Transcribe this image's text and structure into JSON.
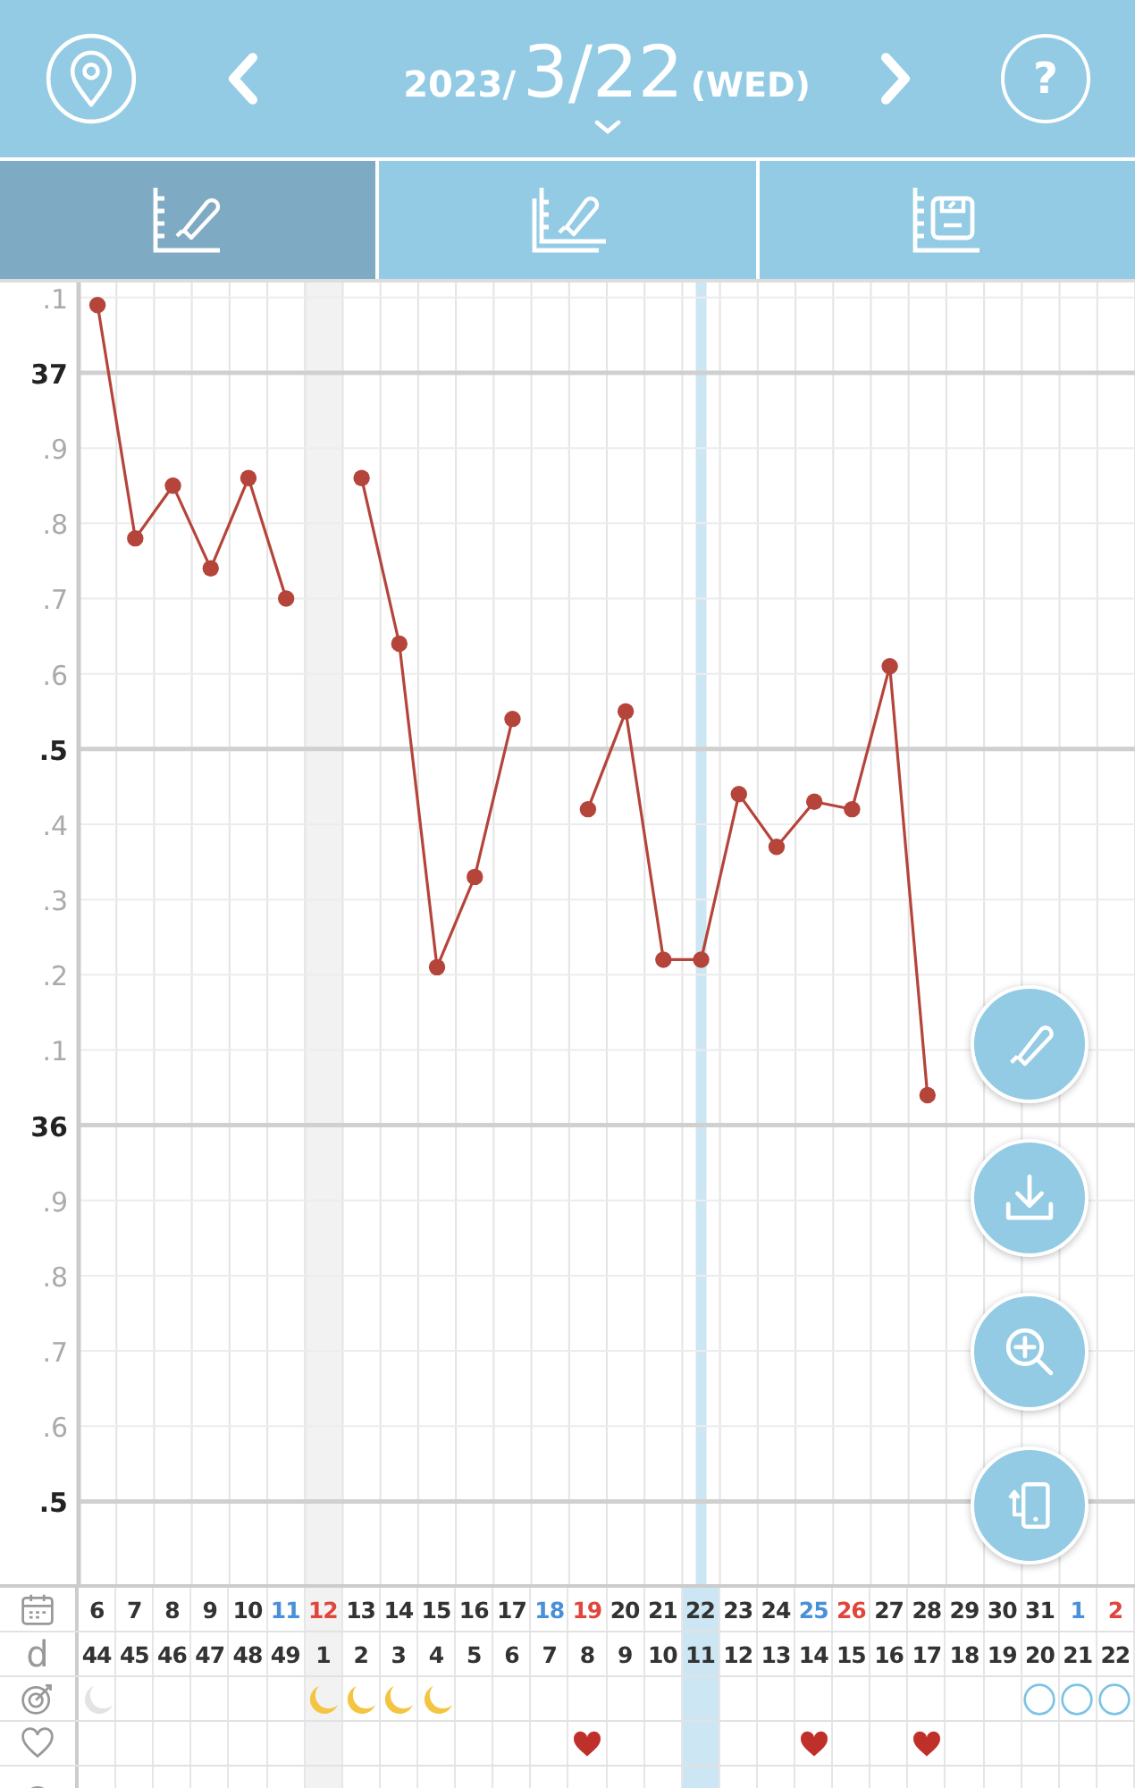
{
  "header": {
    "year": "2023/",
    "date": "3/22",
    "weekday": "(WED)",
    "help_label": "?"
  },
  "tabs": [
    {
      "kind": "thermometer-chart",
      "selected": true
    },
    {
      "kind": "thermometer-chart-stacked",
      "selected": false
    },
    {
      "kind": "scale-chart",
      "selected": false
    }
  ],
  "chart": {
    "chart_data": {
      "type": "line",
      "grid": true,
      "series": [
        {
          "color": "#b5443a",
          "marker": "circle",
          "values": [
            37.09,
            36.78,
            36.85,
            36.74,
            36.86,
            36.7,
            null,
            36.86,
            36.64,
            36.21,
            36.33,
            36.54,
            null,
            36.42,
            36.55,
            36.22,
            36.22,
            36.44,
            36.37,
            36.43,
            36.42,
            36.61,
            36.04,
            null,
            null,
            null,
            null,
            null
          ]
        }
      ],
      "ylim": [
        35.39,
        37.12
      ],
      "yticks": [
        37,
        36
      ]
    },
    "y_axis_labels": [
      ".1",
      "37",
      ".9",
      ".8",
      ".7",
      ".6",
      ".5",
      ".4",
      ".3",
      ".2",
      ".1",
      "36",
      ".9",
      ".8",
      ".7",
      ".6",
      ".5"
    ]
  },
  "row_labels": {
    "cycle_day": "d"
  },
  "days": [
    {
      "date": "6",
      "color": "#333333",
      "cycle_day": "44",
      "kind": "moon-grey",
      "heart": false,
      "selected": false,
      "period_start": false
    },
    {
      "date": "7",
      "color": "#333333",
      "cycle_day": "45",
      "heart": false,
      "selected": false,
      "period_start": false
    },
    {
      "date": "8",
      "color": "#333333",
      "cycle_day": "46",
      "heart": false,
      "selected": false,
      "period_start": false
    },
    {
      "date": "9",
      "color": "#333333",
      "cycle_day": "47",
      "heart": false,
      "selected": false,
      "period_start": false
    },
    {
      "date": "10",
      "color": "#333333",
      "cycle_day": "48",
      "heart": false,
      "selected": false,
      "period_start": false
    },
    {
      "date": "11",
      "color": "#4a90d9",
      "cycle_day": "49",
      "heart": false,
      "selected": false,
      "period_start": false
    },
    {
      "date": "12",
      "color": "#e0463c",
      "cycle_day": "1",
      "kind": "moon-yellow",
      "heart": false,
      "selected": false,
      "period_start": true
    },
    {
      "date": "13",
      "color": "#333333",
      "cycle_day": "2",
      "kind": "moon-yellow",
      "heart": false,
      "selected": false,
      "period_start": false
    },
    {
      "date": "14",
      "color": "#333333",
      "cycle_day": "3",
      "kind": "moon-yellow",
      "heart": false,
      "selected": false,
      "period_start": false
    },
    {
      "date": "15",
      "color": "#333333",
      "cycle_day": "4",
      "kind": "moon-yellow",
      "heart": false,
      "selected": false,
      "period_start": false
    },
    {
      "date": "16",
      "color": "#333333",
      "cycle_day": "5",
      "heart": false,
      "selected": false,
      "period_start": false
    },
    {
      "date": "17",
      "color": "#333333",
      "cycle_day": "6",
      "heart": false,
      "selected": false,
      "period_start": false
    },
    {
      "date": "18",
      "color": "#4a90d9",
      "cycle_day": "7",
      "heart": false,
      "selected": false,
      "period_start": false
    },
    {
      "date": "19",
      "color": "#e0463c",
      "cycle_day": "8",
      "heart": true,
      "selected": false,
      "period_start": false
    },
    {
      "date": "20",
      "color": "#333333",
      "cycle_day": "9",
      "heart": false,
      "selected": false,
      "period_start": false
    },
    {
      "date": "21",
      "color": "#333333",
      "cycle_day": "10",
      "heart": false,
      "selected": false,
      "period_start": false
    },
    {
      "date": "22",
      "color": "#333333",
      "cycle_day": "11",
      "heart": false,
      "selected": true,
      "period_start": false
    },
    {
      "date": "23",
      "color": "#333333",
      "cycle_day": "12",
      "heart": false,
      "selected": false,
      "period_start": false
    },
    {
      "date": "24",
      "color": "#333333",
      "cycle_day": "13",
      "heart": false,
      "selected": false,
      "period_start": false
    },
    {
      "date": "25",
      "color": "#4a90d9",
      "cycle_day": "14",
      "heart": true,
      "selected": false,
      "period_start": false
    },
    {
      "date": "26",
      "color": "#e0463c",
      "cycle_day": "15",
      "heart": false,
      "selected": false,
      "period_start": false
    },
    {
      "date": "27",
      "color": "#333333",
      "cycle_day": "16",
      "heart": false,
      "selected": false,
      "period_start": false
    },
    {
      "date": "28",
      "color": "#333333",
      "cycle_day": "17",
      "heart": true,
      "selected": false,
      "period_start": false
    },
    {
      "date": "29",
      "color": "#333333",
      "cycle_day": "18",
      "heart": false,
      "selected": false,
      "period_start": false
    },
    {
      "date": "30",
      "color": "#333333",
      "cycle_day": "19",
      "heart": false,
      "selected": false,
      "period_start": false
    },
    {
      "date": "31",
      "color": "#333333",
      "cycle_day": "20",
      "kind": "ring",
      "heart": false,
      "selected": false,
      "period_start": false
    },
    {
      "date": "1",
      "color": "#4a90d9",
      "cycle_day": "21",
      "kind": "ring",
      "heart": false,
      "selected": false,
      "period_start": false
    },
    {
      "date": "2",
      "color": "#e0463c",
      "cycle_day": "22",
      "kind": "ring",
      "heart": false,
      "selected": false,
      "period_start": false
    }
  ]
}
